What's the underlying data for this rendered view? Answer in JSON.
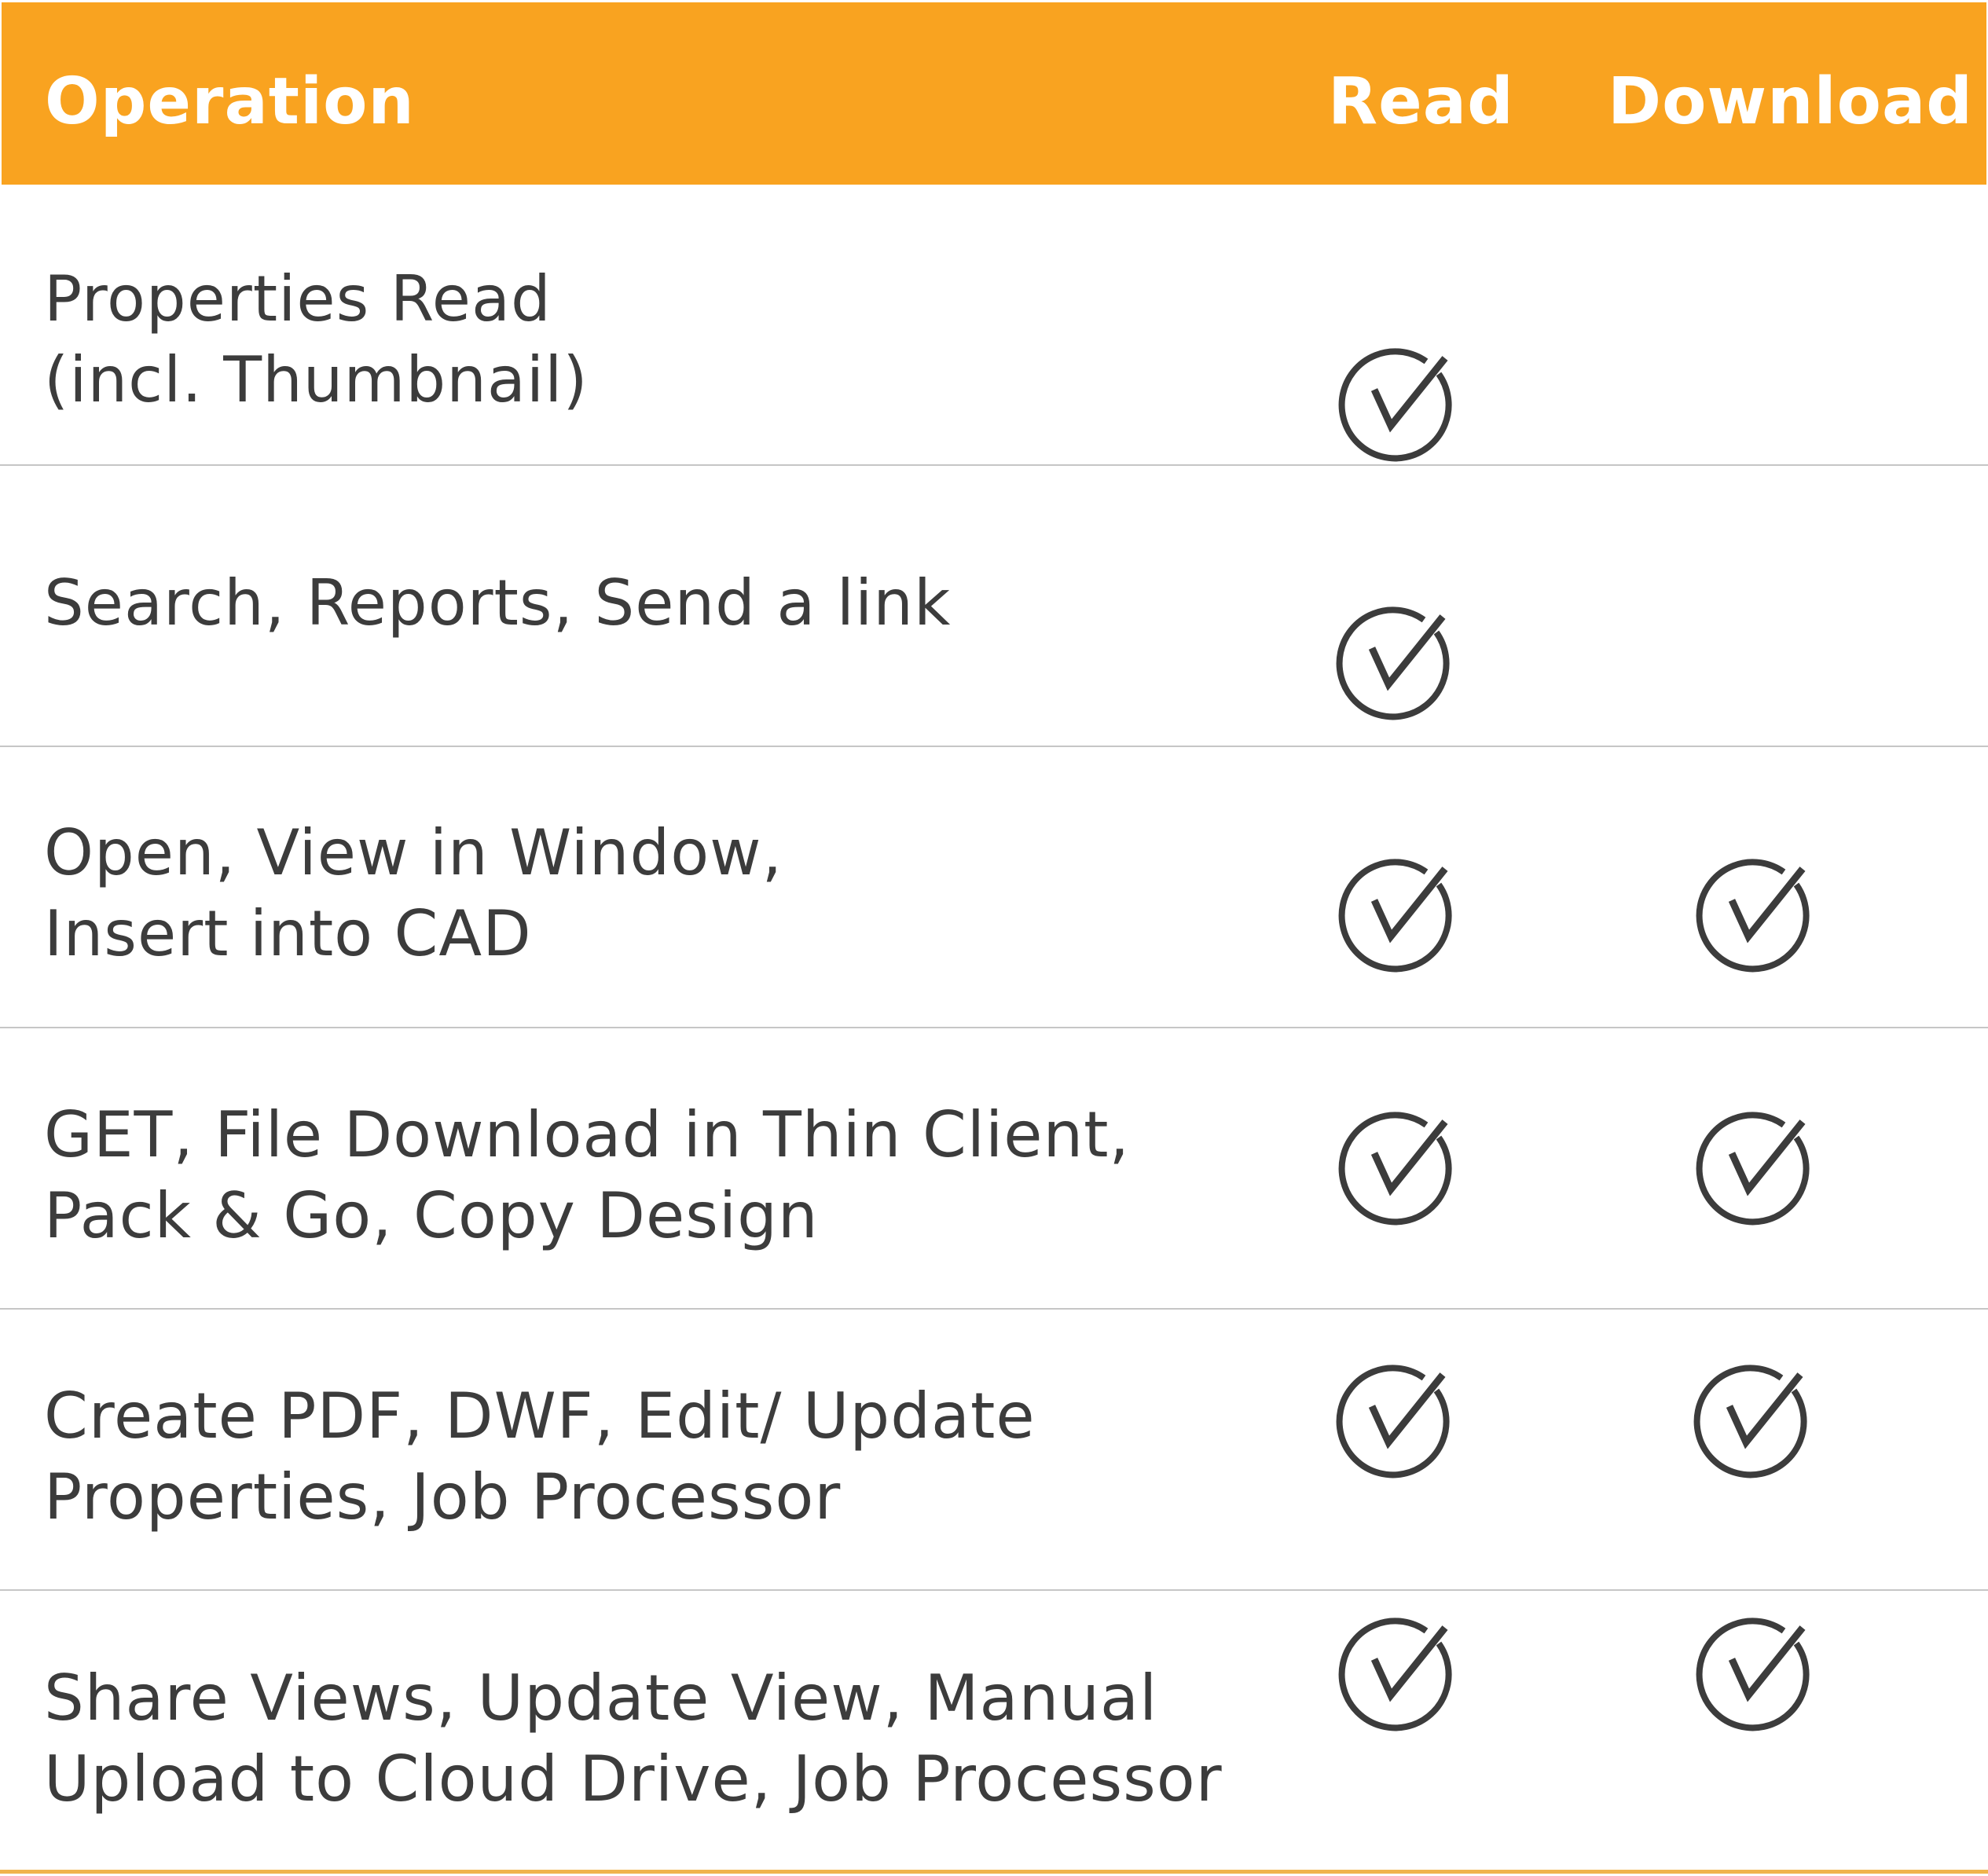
{
  "table": {
    "headers": {
      "operation": "Operation",
      "read": "Read",
      "download": "Download"
    },
    "rows": [
      {
        "lines": [
          "Properties Read",
          "(incl. Thumbnail)"
        ],
        "read": true,
        "download": false
      },
      {
        "lines": [
          "Search, Reports, Send a link"
        ],
        "read": true,
        "download": false
      },
      {
        "lines": [
          "Open, View in Window,",
          "Insert into CAD"
        ],
        "read": true,
        "download": true
      },
      {
        "lines": [
          "GET, File Download in Thin Client,",
          "Pack & Go, Copy Design"
        ],
        "read": true,
        "download": true
      },
      {
        "lines": [
          "Create PDF, DWF, Edit/ Update",
          "Properties, Job Processor"
        ],
        "read": true,
        "download": true
      },
      {
        "lines": [
          "Share Views, Update View, Manual",
          "Upload to Cloud Drive, Job Processor"
        ],
        "read": true,
        "download": true
      }
    ]
  },
  "colors": {
    "header_background": "#f9a320",
    "header_text": "#ffffff",
    "body_text": "#3c3c3c",
    "row_divider": "#c6c6c6",
    "bottom_rule": "#f0b44c"
  },
  "icons": {
    "check": "check-circle-icon"
  }
}
